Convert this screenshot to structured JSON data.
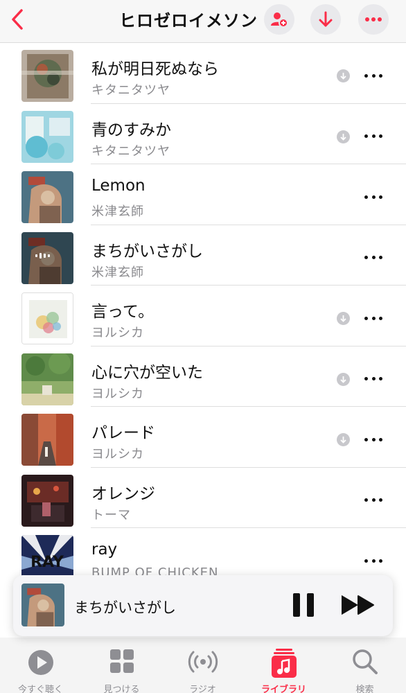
{
  "header": {
    "title": "ヒロゼロイメソン",
    "back_icon": "chevron-left-icon",
    "add_person_icon": "person-add-icon",
    "download_icon": "download-arrow-icon",
    "more_icon": "ellipsis-icon"
  },
  "accent_color": "#fa2d48",
  "songs": [
    {
      "title": "私が明日死ぬなら",
      "artist": "キタニタツヤ",
      "downloaded": true,
      "playing": false
    },
    {
      "title": "青のすみか",
      "artist": "キタニタツヤ",
      "downloaded": true,
      "playing": false
    },
    {
      "title": "Lemon",
      "artist": "米津玄師",
      "downloaded": false,
      "playing": false
    },
    {
      "title": "まちがいさがし",
      "artist": "米津玄師",
      "downloaded": false,
      "playing": true
    },
    {
      "title": "言って。",
      "artist": "ヨルシカ",
      "downloaded": true,
      "playing": false
    },
    {
      "title": "心に穴が空いた",
      "artist": "ヨルシカ",
      "downloaded": true,
      "playing": false
    },
    {
      "title": "パレード",
      "artist": "ヨルシカ",
      "downloaded": true,
      "playing": false
    },
    {
      "title": "オレンジ",
      "artist": "トーマ",
      "downloaded": false,
      "playing": false
    },
    {
      "title": "ray",
      "artist": "BUMP OF CHICKEN",
      "downloaded": false,
      "playing": false
    }
  ],
  "mini_player": {
    "title": "まちがいさがし",
    "pause_icon": "pause-icon",
    "forward_icon": "fast-forward-icon"
  },
  "tabs": [
    {
      "label": "今すぐ聴く",
      "icon": "play-circle-icon",
      "active": false
    },
    {
      "label": "見つける",
      "icon": "grid-icon",
      "active": false
    },
    {
      "label": "ラジオ",
      "icon": "radio-waves-icon",
      "active": false
    },
    {
      "label": "ライブラリ",
      "icon": "library-music-icon",
      "active": true
    },
    {
      "label": "検索",
      "icon": "search-icon",
      "active": false
    }
  ]
}
